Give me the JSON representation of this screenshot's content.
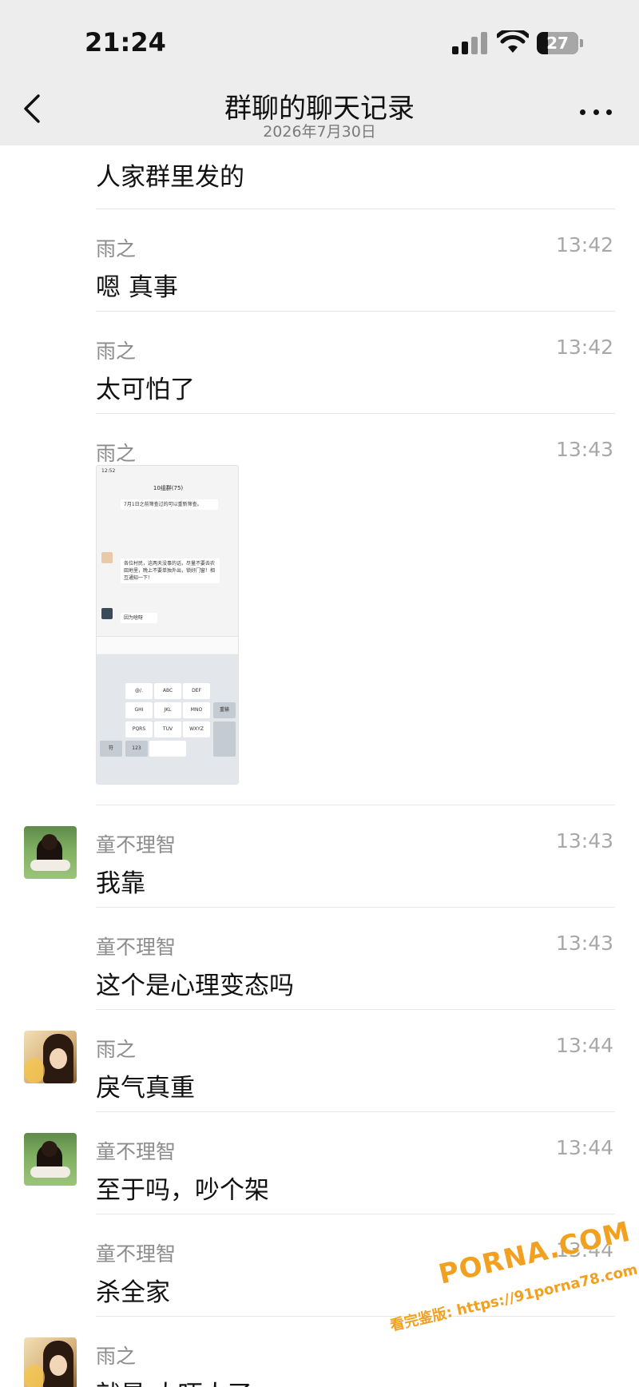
{
  "status_bar": {
    "time": "21:24",
    "battery": "27"
  },
  "nav": {
    "title": "群聊的聊天记录",
    "subtitle": "2026年7月30日"
  },
  "messages": [
    {
      "sender": "",
      "time": "",
      "text": "人家群里发的"
    },
    {
      "sender": "雨之",
      "time": "13:42",
      "text": "嗯 真事"
    },
    {
      "sender": "雨之",
      "time": "13:42",
      "text": "太可怕了"
    },
    {
      "sender": "雨之",
      "time": "13:43",
      "text": ""
    },
    {
      "sender": "童不理智",
      "time": "13:43",
      "text": "我靠"
    },
    {
      "sender": "童不理智",
      "time": "13:43",
      "text": "这个是心理变态吗"
    },
    {
      "sender": "雨之",
      "time": "13:44",
      "text": "戾气真重"
    },
    {
      "sender": "童不理智",
      "time": "13:44",
      "text": "至于吗，吵个架"
    },
    {
      "sender": "童不理智",
      "time": "13:44",
      "text": "杀全家"
    },
    {
      "sender": "雨之",
      "time": "",
      "text": "就是 太吓人了"
    }
  ],
  "embedded_screenshot": {
    "status_time": "12:52",
    "title": "10组群(75)",
    "msg_top": "7月1日之前筛查过的可以重新筛查。",
    "msg_main": "各位村民，这两天没事的话，尽量不要去农田地里，晚上不要单独外出，锁好门窗！相互通知一下！",
    "msg_reply": "因为啥呀",
    "keys": [
      "@/.",
      "ABC",
      "DEF",
      "GHI",
      "JKL",
      "MNO",
      "PQRS",
      "TUV",
      "WXYZ",
      "重输",
      "符",
      "123"
    ]
  },
  "watermark": {
    "brand": "PORNA.COM",
    "url_line": "看完鉴版: https://91porna78.com"
  },
  "colors": {
    "nav_bg": "#ededed",
    "watermark": "#f2a020"
  }
}
